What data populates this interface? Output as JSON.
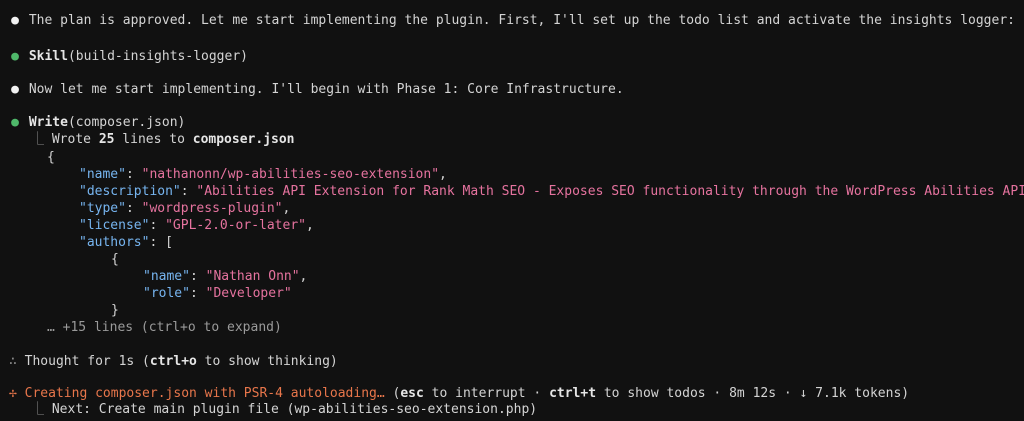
{
  "terminal": {
    "bullet_glyph": "●",
    "tree_glyph": "⎿",
    "thought_glyph": "∴",
    "spinner_glyph": "✢",
    "lines": {
      "intro": "The plan is approved. Let me start implementing the plugin. First, I'll set up the todo list and activate the insights logger:",
      "skill_tool": "Skill",
      "skill_args": "(build-insights-logger)",
      "phase": "Now let me start implementing. I'll begin with Phase 1: Core Infrastructure.",
      "write_tool": "Write",
      "write_args": "(composer.json)",
      "wrote_prefix": "Wrote ",
      "wrote_count": "25",
      "wrote_mid": " lines to ",
      "wrote_file": "composer.json",
      "more_lines": "… +15 lines (ctrl+o to expand)",
      "thought_prefix": "Thought for 1s (",
      "thought_key": "ctrl+o",
      "thought_suffix": " to show thinking)",
      "status_action": "Creating composer.json with PSR-4 autoloading…",
      "status_paren_open": " (",
      "status_esc": "esc",
      "status_esc_text": " to interrupt · ",
      "status_ctrl": "ctrl+t",
      "status_ctrl_text": " to show todos · 8m 12s · ↓ 7.1k tokens)",
      "next": "Next: Create main plugin file (wp-abilities-seo-extension.php)"
    },
    "json_code": {
      "open_brace": "{",
      "name_key": "\"name\"",
      "name_val": "\"nathanonn/wp-abilities-seo-extension\"",
      "desc_key": "\"description\"",
      "desc_val": "\"Abilities API Extension for Rank Math SEO - Exposes SEO functionality through the WordPress Abilities API",
      "type_key": "\"type\"",
      "type_val": "\"wordpress-plugin\"",
      "license_key": "\"license\"",
      "license_val": "\"GPL-2.0-or-later\"",
      "authors_key": "\"authors\"",
      "authors_open": "[",
      "author_open": "{",
      "author_name_key": "\"name\"",
      "author_name_val": "\"Nathan Onn\"",
      "author_role_key": "\"role\"",
      "author_role_val": "\"Developer\"",
      "author_close": "}"
    },
    "colors": {
      "background": "#111111",
      "text": "#d4d4d4",
      "json_key": "#77b5f0",
      "json_string": "#e6739f",
      "bullet_done": "#4fb86a",
      "spinner": "#e8764b"
    }
  }
}
